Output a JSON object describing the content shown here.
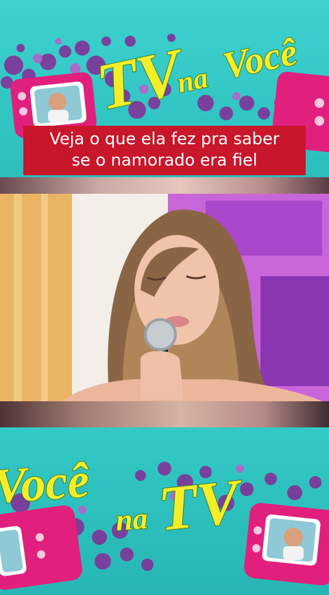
{
  "caption": {
    "line1": "Veja o que ela fez pra saber",
    "line2": "se o namorado era fiel"
  },
  "logo": {
    "word1": "Você",
    "word2": "na",
    "word3": "TV"
  },
  "colors": {
    "teal_background": "#2fc7c3",
    "caption_red": "#c8162a",
    "logo_yellow": "#f4ee2a",
    "tv_pink": "#e0207c",
    "bubble_purple": "#7d3a9a"
  },
  "icons": [
    "tv-set-icon",
    "bubble-cluster"
  ]
}
